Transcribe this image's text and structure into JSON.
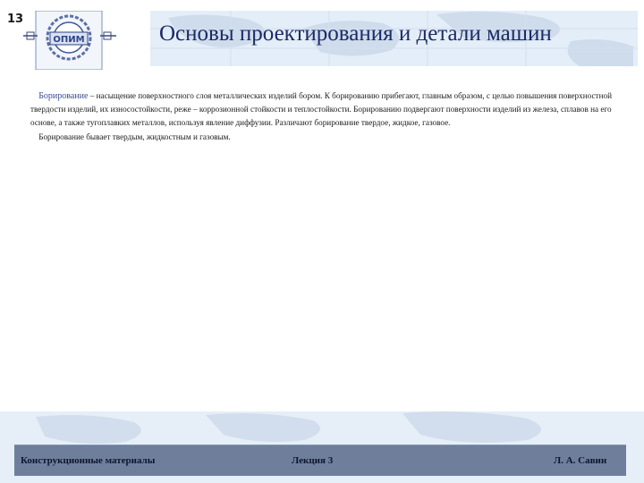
{
  "slide": {
    "number": "13",
    "title": "Основы проектирования и детали машин",
    "logo_text": "ОПИМ"
  },
  "content": {
    "term": "Борирование",
    "para1_rest": " – насыщение поверхностного слоя металлических изделий бором. К борированию прибегают, главным образом, с целью повышения поверхностной твердости изделий, их износостойкости, реже – коррозионной стойкости и теплостойкости. Борированию подвергают поверхности изделий из железа, сплавов на его основе, а также тугоплавких металлов, используя явление диффузии. Различают борирование твердое, жидкое, газовое.",
    "para2": "Борирование бывает твердым, жидкостным и газовым."
  },
  "footer": {
    "left": "Конструкционные материалы",
    "center": "Лекция 3",
    "right": "Л. А. Савин"
  },
  "colors": {
    "title": "#1c2a66",
    "header_band": "#e4eef8",
    "footer_bar": "#6f7f9b",
    "term": "#3b4d8f"
  }
}
